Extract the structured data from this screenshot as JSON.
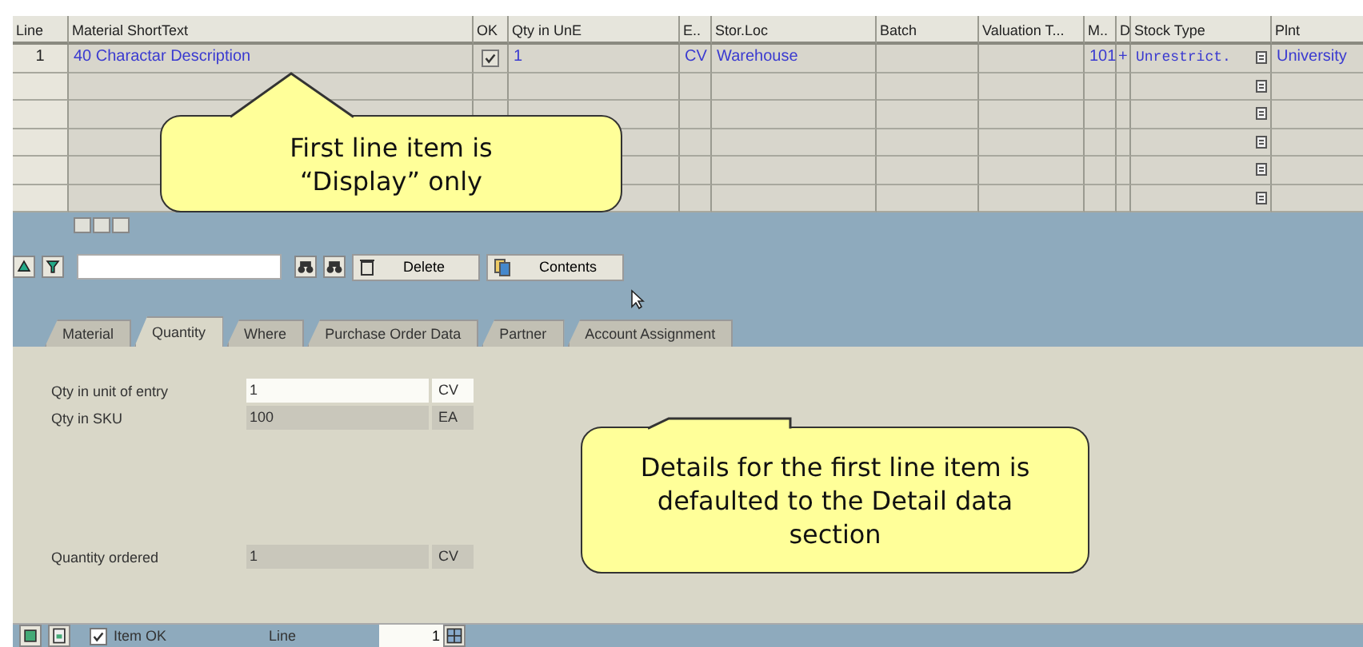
{
  "grid": {
    "columns": [
      "Line",
      "Material ShortText",
      "OK",
      "Qty in UnE",
      "E..",
      "Stor.Loc",
      "Batch",
      "Valuation T...",
      "M..",
      "D",
      "Stock Type",
      "Plnt"
    ],
    "rows": [
      {
        "kind": "item",
        "line": "1",
        "material": "40 Charactar Description",
        "ok": true,
        "qty": "1",
        "unit": "CV",
        "stor_loc": "Warehouse",
        "movement": "101",
        "debit": "+",
        "stock_type": "Unrestrict.",
        "plant": "University"
      },
      {
        "kind": "empty"
      },
      {
        "kind": "empty"
      },
      {
        "kind": "empty"
      },
      {
        "kind": "empty"
      },
      {
        "kind": "empty"
      }
    ]
  },
  "toolbar": {
    "buttons": [
      "Delete",
      "Contents"
    ]
  },
  "tabs": [
    {
      "label": "Material",
      "selected": false
    },
    {
      "label": "Quantity",
      "selected": true
    },
    {
      "label": "Where",
      "selected": false
    },
    {
      "label": "Purchase Order Data",
      "selected": false
    },
    {
      "label": "Partner",
      "selected": false
    },
    {
      "label": "Account Assignment",
      "selected": false
    }
  ],
  "fields": [
    {
      "label": "Qty in unit of entry",
      "value": "1",
      "unit": "CV",
      "disabled": false,
      "gap_before": false
    },
    {
      "label": "Qty in SKU",
      "value": "100",
      "unit": "EA",
      "disabled": true,
      "gap_before": false
    },
    {
      "label": "Quantity ordered",
      "value": "1",
      "unit": "CV",
      "disabled": true,
      "gap_before": true
    }
  ],
  "footer": {
    "item_ok": {
      "label": "Item OK",
      "checked": true
    },
    "line_label": "Line",
    "line_value": "1"
  },
  "callouts": [
    {
      "text": "First line item is “Display” only",
      "kind": "up"
    },
    {
      "text": "Details for the first line item is defaulted to the Detail data section",
      "kind": "notch"
    }
  ]
}
